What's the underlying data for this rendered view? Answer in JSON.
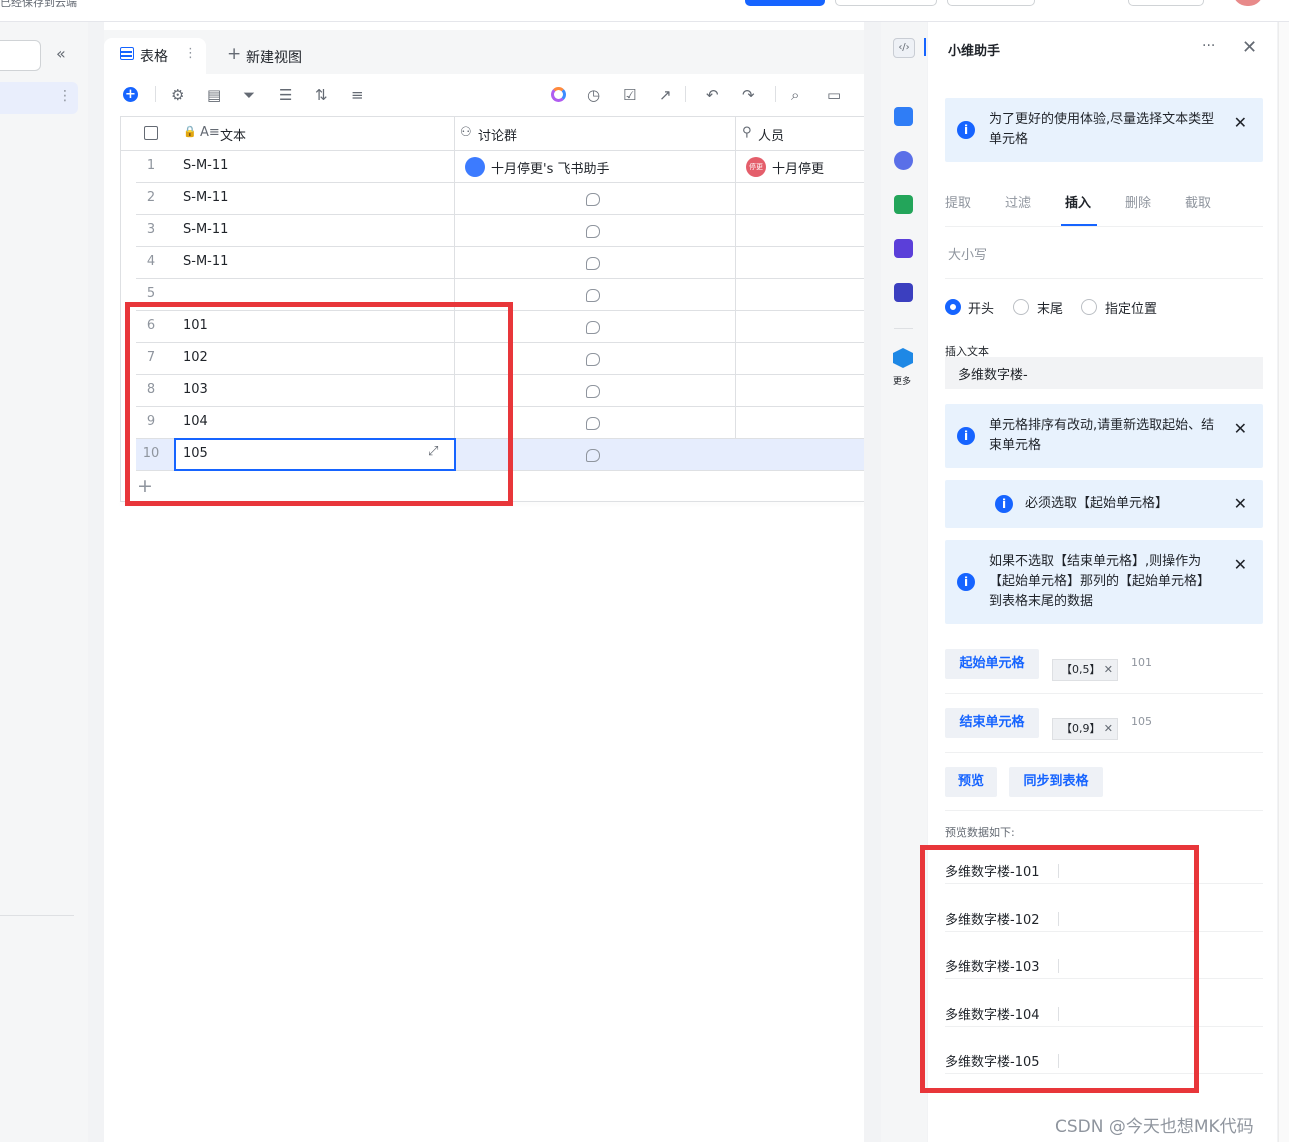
{
  "app": {
    "saved_status": "已经保存到云端"
  },
  "tabs": [
    {
      "label": "表格"
    },
    {
      "label": "新建视图"
    }
  ],
  "table": {
    "columns": [
      {
        "label": "文本"
      },
      {
        "label": "讨论群"
      },
      {
        "label": "人员"
      }
    ],
    "rows": [
      {
        "num": "1",
        "text": "S-M-11",
        "group": "十月停更's 飞书助手",
        "person": "十月停更",
        "avatar": "停更"
      },
      {
        "num": "2",
        "text": "S-M-11"
      },
      {
        "num": "3",
        "text": "S-M-11"
      },
      {
        "num": "4",
        "text": "S-M-11"
      },
      {
        "num": "5",
        "text": ""
      },
      {
        "num": "6",
        "text": "101"
      },
      {
        "num": "7",
        "text": "102"
      },
      {
        "num": "8",
        "text": "103"
      },
      {
        "num": "9",
        "text": "104"
      },
      {
        "num": "10",
        "text": "105"
      }
    ],
    "add_row": "+"
  },
  "side_nav": {
    "more_label": "更多"
  },
  "panel": {
    "title": "小维助手",
    "notice_1": "为了更好的使用体验,尽量选择文本类型单元格",
    "tabs": [
      "提取",
      "过滤",
      "插入",
      "删除",
      "截取"
    ],
    "active_tab": "插入",
    "sub_option": "大小写",
    "radios": [
      "开头",
      "末尾",
      "指定位置"
    ],
    "insert_label": "插入文本",
    "insert_value": "多维数字楼-",
    "notice_2": "单元格排序有改动,请重新选取起始、结束单元格",
    "notice_3": "必须选取【起始单元格】",
    "notice_4": "如果不选取【结束单元格】,则操作为【起始单元格】那列的【起始单元格】到表格末尾的数据",
    "start_button": "起始单元格",
    "start_chip": "【0,5】",
    "start_value": "101",
    "end_button": "结束单元格",
    "end_chip": "【0,9】",
    "end_value": "105",
    "preview_button": "预览",
    "sync_button": "同步到表格",
    "preview_heading": "预览数据如下:",
    "preview_items": [
      "多维数字楼-101",
      "多维数字楼-102",
      "多维数字楼-103",
      "多维数字楼-104",
      "多维数字楼-105"
    ]
  },
  "watermark": "CSDN @今天也想MK代码"
}
